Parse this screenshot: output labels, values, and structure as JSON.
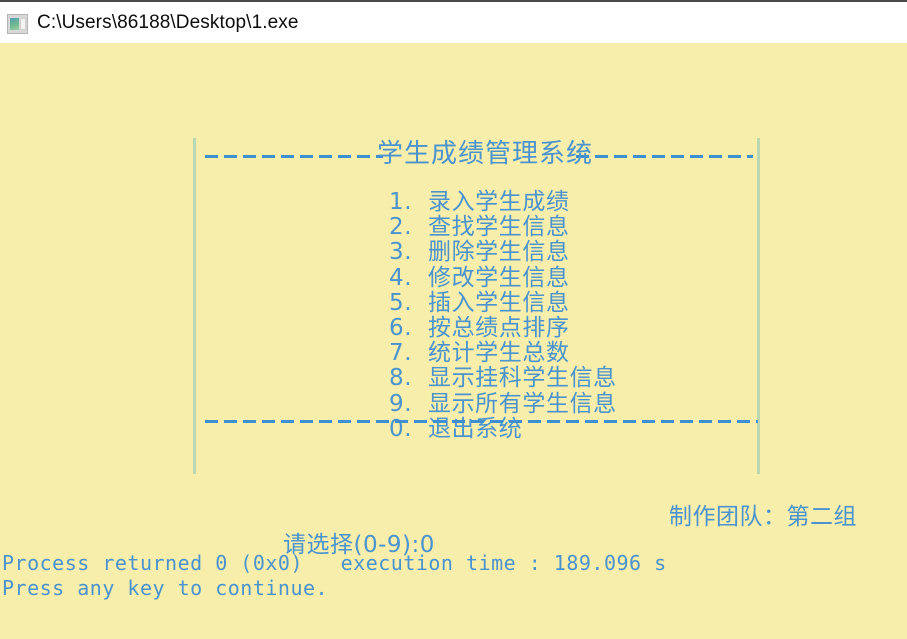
{
  "window": {
    "title": "C:\\Users\\86188\\Desktop\\1.exe",
    "icon": "console-window-icon"
  },
  "console": {
    "background_color": "#f7eeab",
    "text_color": "#4a93cf",
    "border_color": "#b9d7b0",
    "menu": {
      "title": "学生成绩管理系统",
      "title_rule_char": "-",
      "rule_left_count": 15,
      "rule_right_count": 15,
      "bottom_rule_count": 46,
      "items": [
        {
          "key": "1.",
          "label": "录入学生成绩"
        },
        {
          "key": "2.",
          "label": "查找学生信息"
        },
        {
          "key": "3.",
          "label": "删除学生信息"
        },
        {
          "key": "4.",
          "label": "修改学生信息"
        },
        {
          "key": "5.",
          "label": "插入学生信息"
        },
        {
          "key": "6.",
          "label": "按总绩点排序"
        },
        {
          "key": "7.",
          "label": "统计学生总数"
        },
        {
          "key": "8.",
          "label": "显示挂科学生信息"
        },
        {
          "key": "9.",
          "label": "显示所有学生信息"
        },
        {
          "key": "0.",
          "label": "退出系统"
        }
      ]
    },
    "team_credit": "制作团队：第二组",
    "choice_prompt": "请选择(0-9):0",
    "process_returned": "Process returned 0 (0x0)   execution time : 189.096 s",
    "press_any_key": "Press any key to continue."
  }
}
